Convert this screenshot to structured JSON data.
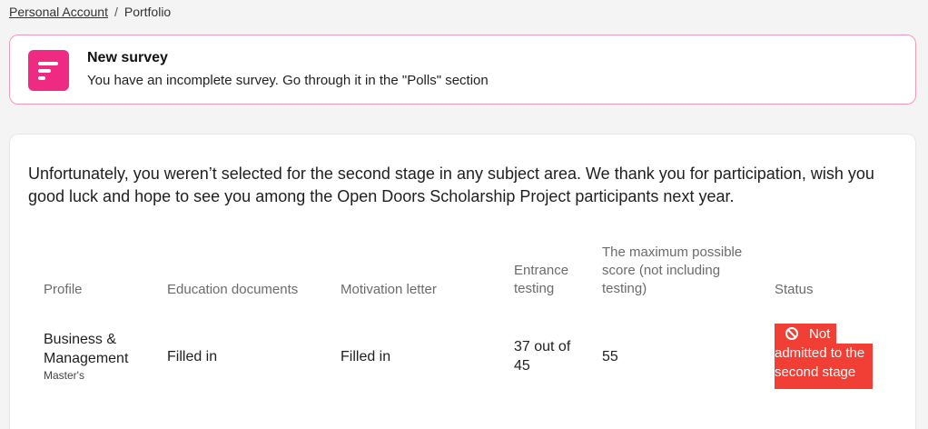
{
  "breadcrumb": {
    "parent": "Personal Account",
    "separator": "/",
    "current": "Portfolio"
  },
  "survey": {
    "title": "New survey",
    "text": "You have an incomplete survey. Go through it in the \"Polls\" section",
    "icon": "survey-icon",
    "accent": "#ef2a82"
  },
  "result": {
    "message": "Unfortunately, you weren’t selected for the second stage in any subject area. We thank you for participation, wish you good luck and hope to see you among the Open Doors Scholarship Project participants next year."
  },
  "table": {
    "headers": {
      "profile": "Profile",
      "education": "Education documents",
      "motivation": "Motivation letter",
      "testing": "Entrance testing",
      "max_score": "The maximum possible score (not including testing)",
      "status": "Status"
    },
    "rows": [
      {
        "profile": "Business & Management",
        "degree": "Master's",
        "education": "Filled in",
        "motivation": "Filled in",
        "testing": "37 out of 45",
        "max_score": "55",
        "status": "Not admitted to the second stage",
        "status_color": "#f23f35",
        "status_icon": "ban-icon"
      }
    ]
  }
}
